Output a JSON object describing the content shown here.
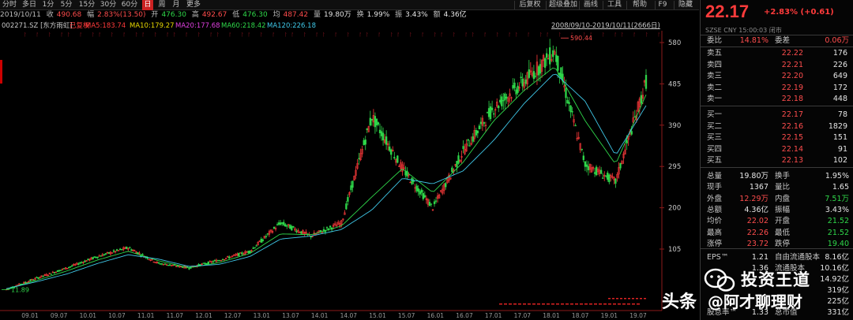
{
  "toolbar": {
    "periods": [
      "分时",
      "多日",
      "1分",
      "5分",
      "15分",
      "30分",
      "60分",
      "日",
      "周",
      "月",
      "更多"
    ],
    "active_period": "日",
    "right_items": [
      "后复权",
      "超级叠加",
      "画线",
      "工具",
      "帮助",
      "F9",
      "隐藏"
    ]
  },
  "quote": {
    "date": "2019/10/11",
    "close_label": "收",
    "close": "490.68",
    "change_label": "幅",
    "change": "2.83%(13.50)",
    "open_label": "开",
    "open": "476.30",
    "high_label": "高",
    "high": "492.67",
    "low_label": "低",
    "low": "476.30",
    "avg_label": "均",
    "avg": "487.42",
    "vol_label": "量",
    "vol": "19.80万",
    "turnover_label": "换",
    "turnover": "1.99%",
    "amp_label": "振",
    "amp": "3.43%",
    "amount_label": "额",
    "amount": "4.36亿"
  },
  "ma_row": {
    "code": "002271.SZ [东方雨虹]",
    "adj": "已复权",
    "ma5": "MA5:183.74",
    "ma10": "MA10:179.27",
    "ma20": "MA20:177.68",
    "ma60": "MA60:218.42",
    "ma120": "MA120:226.18",
    "range": "2008/09/10-2019/10/11(2666日)"
  },
  "colors": {
    "ma5": "#ffffff",
    "ma10": "#e8d800",
    "ma20": "#e040e0",
    "ma60": "#2fd84a",
    "ma120": "#3fc8e8",
    "up": "#ff3b3b",
    "down": "#2fd84a",
    "bg": "#000000"
  },
  "chart_data": {
    "type": "line",
    "title": "",
    "y_ticks": [
      580,
      485,
      390,
      295,
      200,
      105
    ],
    "ylim": [
      0,
      600
    ],
    "x_tick_labels": [
      "09.01",
      "09.07",
      "10.01",
      "10.07",
      "11.01",
      "11.07",
      "12.01",
      "12.07",
      "13.01",
      "13.07",
      "14.01",
      "14.07",
      "15.01",
      "15.07",
      "16.01",
      "16.07",
      "17.01",
      "17.07",
      "18.01",
      "18.07",
      "19.01",
      "19.07"
    ],
    "annotations": [
      {
        "label": "590.44",
        "x": "18.01",
        "y": 590.44
      },
      {
        "label": "11.89",
        "x": "09.01",
        "y": 11.89
      }
    ],
    "series": [
      {
        "name": "MA120",
        "x": [
          "09.01",
          "09.07",
          "10.01",
          "10.07",
          "11.01",
          "11.07",
          "12.01",
          "12.07",
          "13.01",
          "13.07",
          "14.01",
          "14.07",
          "15.01",
          "15.07",
          "16.01",
          "16.07",
          "17.01",
          "17.07",
          "18.01",
          "18.07",
          "19.01",
          "19.07"
        ],
        "values": [
          14,
          30,
          48,
          72,
          92,
          82,
          65,
          70,
          88,
          128,
          135,
          150,
          195,
          268,
          255,
          285,
          355,
          440,
          510,
          445,
          320,
          435
        ]
      },
      {
        "name": "MA60",
        "x": [
          "09.01",
          "09.07",
          "10.01",
          "10.07",
          "11.01",
          "11.07",
          "12.01",
          "12.07",
          "13.01",
          "13.07",
          "14.01",
          "14.07",
          "15.01",
          "15.07",
          "16.01",
          "16.07",
          "17.01",
          "17.07",
          "18.01",
          "18.07",
          "19.01",
          "19.07"
        ],
        "values": [
          13,
          33,
          55,
          80,
          100,
          78,
          62,
          74,
          95,
          140,
          138,
          158,
          225,
          290,
          235,
          305,
          400,
          470,
          525,
          400,
          300,
          460
        ]
      },
      {
        "name": "Price",
        "x": [
          "09.01",
          "09.07",
          "10.01",
          "10.07",
          "11.01",
          "11.07",
          "12.01",
          "12.07",
          "13.01",
          "13.07",
          "14.01",
          "14.07",
          "15.01",
          "15.07",
          "16.01",
          "16.07",
          "17.01",
          "17.07",
          "18.01",
          "18.07",
          "19.01",
          "19.07"
        ],
        "values": [
          12,
          38,
          62,
          88,
          108,
          72,
          62,
          80,
          100,
          165,
          135,
          165,
          410,
          290,
          200,
          330,
          430,
          490,
          560,
          300,
          260,
          490
        ]
      }
    ]
  },
  "panel": {
    "price": "22.17",
    "change": "+2.83% (+0.61)",
    "sub": "SZSE  CNY  15:00:03  闭市",
    "weibi_label": "委比",
    "weibi": "14.81%",
    "weicha_label": "委差",
    "weicha": "0.06万",
    "asks": [
      {
        "label": "卖五",
        "price": "22.22",
        "vol": "176"
      },
      {
        "label": "卖四",
        "price": "22.21",
        "vol": "226"
      },
      {
        "label": "卖三",
        "price": "22.20",
        "vol": "649"
      },
      {
        "label": "卖二",
        "price": "22.19",
        "vol": "172"
      },
      {
        "label": "卖一",
        "price": "22.18",
        "vol": "448"
      }
    ],
    "bids": [
      {
        "label": "买一",
        "price": "22.17",
        "vol": "78"
      },
      {
        "label": "买二",
        "price": "22.16",
        "vol": "1829"
      },
      {
        "label": "买三",
        "price": "22.15",
        "vol": "151"
      },
      {
        "label": "买四",
        "price": "22.14",
        "vol": "91"
      },
      {
        "label": "买五",
        "price": "22.13",
        "vol": "102"
      }
    ],
    "stats": [
      {
        "l1": "总量",
        "v1": "19.80万",
        "c1": "white",
        "l2": "换手",
        "v2": "1.95%",
        "c2": "white"
      },
      {
        "l1": "现手",
        "v1": "1367",
        "c1": "white",
        "l2": "量比",
        "v2": "1.65",
        "c2": "white"
      },
      {
        "l1": "外盘",
        "v1": "12.29万",
        "c1": "red",
        "l2": "内盘",
        "v2": "7.51万",
        "c2": "green"
      },
      {
        "l1": "总额",
        "v1": "4.36亿",
        "c1": "white",
        "l2": "振幅",
        "v2": "3.43%",
        "c2": "white"
      },
      {
        "l1": "均价",
        "v1": "22.02",
        "c1": "red",
        "l2": "开盘",
        "v2": "21.52",
        "c2": "green"
      },
      {
        "l1": "最高",
        "v1": "22.26",
        "c1": "red",
        "l2": "最低",
        "v2": "21.52",
        "c2": "green"
      },
      {
        "l1": "涨停",
        "v1": "23.72",
        "c1": "red",
        "l2": "跌停",
        "v2": "19.40",
        "c2": "green"
      }
    ],
    "fund": [
      {
        "l1": "EPS™",
        "v1": "1.21",
        "l2": "自由流通股本",
        "v2": "8.16亿"
      },
      {
        "l1": "",
        "v1": "1.36",
        "l2": "流通股本",
        "v2": "10.16亿"
      },
      {
        "l1": "",
        "v1": "",
        "l2": "",
        "v2": "14.92亿"
      },
      {
        "l1": "",
        "v1": "",
        "l2": "",
        "v2": "319亿"
      },
      {
        "l1": "",
        "v1": "",
        "l2": "",
        "v2": "225亿"
      },
      {
        "l1": "股息率™",
        "v1": "1.33",
        "l2": "总市值",
        "v2": "331亿"
      }
    ]
  },
  "watermark": {
    "line1": "投资王道",
    "line2": "头条",
    "line3": "@阿才聊理财"
  }
}
